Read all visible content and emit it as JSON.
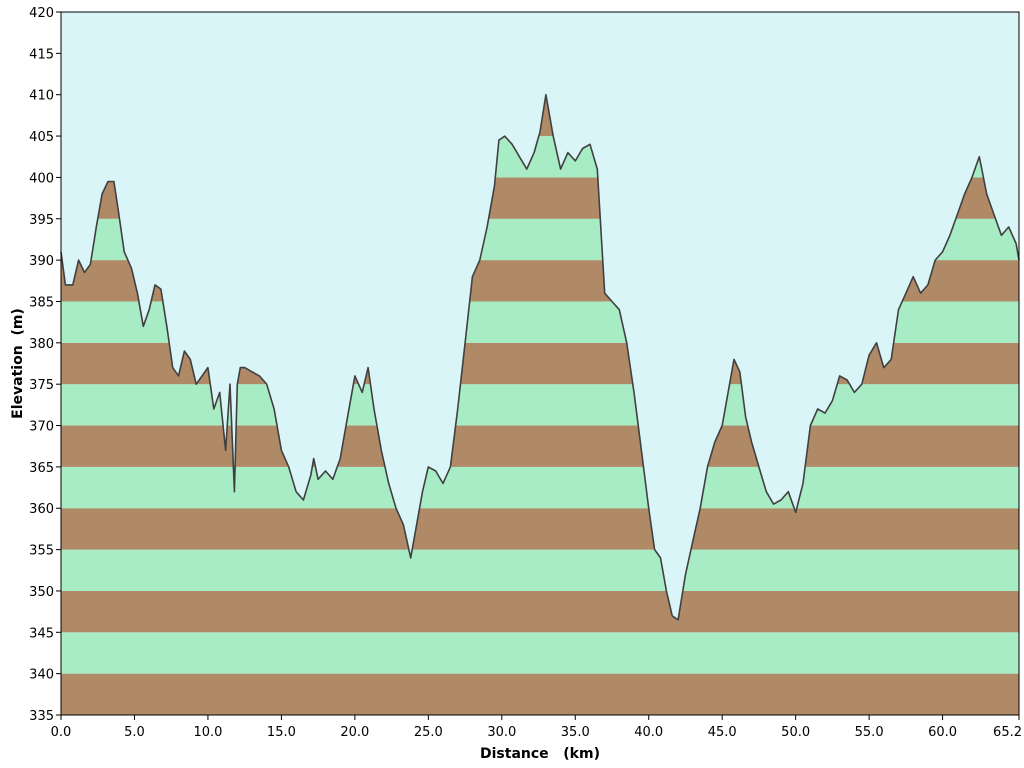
{
  "colors": {
    "sky": "#d9f5f7",
    "band_green": "#a8ecc6",
    "band_brown": "#b08a66",
    "profile_line": "#404040",
    "axis": "#000000"
  },
  "chart_data": {
    "type": "area",
    "title": "",
    "xlabel": "Distance   (km)",
    "ylabel": "Elevation  (m)",
    "xlim": [
      0,
      65.2
    ],
    "ylim": [
      335,
      420
    ],
    "grid": false,
    "x_ticks": [
      0,
      5,
      10,
      15,
      20,
      25,
      30,
      35,
      40,
      45,
      50,
      55,
      60,
      65.2
    ],
    "x_tick_labels": [
      "0.0",
      "5.0",
      "10.0",
      "15.0",
      "20.0",
      "25.0",
      "30.0",
      "35.0",
      "40.0",
      "45.0",
      "50.0",
      "55.0",
      "60.0",
      "65.2"
    ],
    "y_ticks": [
      335,
      340,
      345,
      350,
      355,
      360,
      365,
      370,
      375,
      380,
      385,
      390,
      395,
      400,
      405,
      410,
      415,
      420
    ],
    "y_tick_labels": [
      "335",
      "340",
      "345",
      "350",
      "355",
      "360",
      "365",
      "370",
      "375",
      "380",
      "385",
      "390",
      "395",
      "400",
      "405",
      "410",
      "415",
      "420"
    ],
    "band_height": 5,
    "series": [
      {
        "x": [
          0,
          0.3,
          0.8,
          1.2,
          1.6,
          2.0,
          2.4,
          2.8,
          3.2,
          3.6,
          3.9,
          4.3,
          4.8,
          5.2,
          5.6,
          6.0,
          6.4,
          6.8,
          7.2,
          7.6,
          8.0,
          8.4,
          8.8,
          9.2,
          9.6,
          10.0,
          10.4,
          10.8,
          11.2,
          11.5,
          11.8,
          12.0,
          12.2,
          12.5,
          13.0,
          13.5,
          14.0,
          14.5,
          15.0,
          15.5,
          16.0,
          16.5,
          17.0,
          17.2,
          17.5,
          18.0,
          18.5,
          19.0,
          19.5,
          20.0,
          20.5,
          20.9,
          21.3,
          21.8,
          22.3,
          22.8,
          23.3,
          23.8,
          24.2,
          24.6,
          25.0,
          25.5,
          26.0,
          26.5,
          27.0,
          27.5,
          28.0,
          28.5,
          29.0,
          29.5,
          29.8,
          30.2,
          30.7,
          31.2,
          31.7,
          32.2,
          32.6,
          33.0,
          33.5,
          34.0,
          34.5,
          35.0,
          35.5,
          36.0,
          36.5,
          37.0,
          37.5,
          38.0,
          38.5,
          39.0,
          39.5,
          40.0,
          40.4,
          40.8,
          41.2,
          41.6,
          42.0,
          42.5,
          43.0,
          43.5,
          44.0,
          44.5,
          45.0,
          45.4,
          45.8,
          46.2,
          46.6,
          47.0,
          47.5,
          48.0,
          48.5,
          49.0,
          49.5,
          50.0,
          50.5,
          51.0,
          51.5,
          52.0,
          52.5,
          53.0,
          53.5,
          54.0,
          54.5,
          55.0,
          55.5,
          56.0,
          56.5,
          57.0,
          57.5,
          58.0,
          58.5,
          59.0,
          59.5,
          60.0,
          60.5,
          61.0,
          61.5,
          62.0,
          62.5,
          63.0,
          63.5,
          64.0,
          64.5,
          65.0,
          65.2
        ],
        "y": [
          391,
          387,
          387,
          390,
          388.5,
          389.5,
          394,
          398,
          399.5,
          399.5,
          396,
          391,
          389,
          386,
          382,
          384,
          387,
          386.5,
          382,
          377,
          376,
          379,
          378,
          375,
          376,
          377,
          372,
          374,
          367,
          375,
          362,
          375,
          377,
          377,
          376.5,
          376,
          375,
          372,
          367,
          365,
          362,
          361,
          364,
          366,
          363.5,
          364.5,
          363.5,
          366,
          371,
          376,
          374,
          377,
          372,
          367,
          363,
          360,
          358,
          354,
          358,
          362,
          365,
          364.5,
          363,
          365,
          372,
          380,
          388,
          390,
          394,
          399,
          404.5,
          405,
          404,
          402.5,
          401,
          403,
          405.5,
          410,
          405,
          401,
          403,
          402,
          403.5,
          404,
          401,
          386,
          385,
          384,
          380,
          374,
          367,
          360,
          355,
          354,
          350,
          347,
          346.5,
          352,
          356,
          360,
          365,
          368,
          370,
          374,
          378,
          376.5,
          371,
          368,
          365,
          362,
          360.5,
          361,
          362,
          359.5,
          363,
          370,
          372,
          371.5,
          373,
          376,
          375.5,
          374,
          375,
          378.5,
          380,
          377,
          378,
          384,
          386,
          388,
          386,
          387,
          390,
          391,
          393,
          395.5,
          398,
          400,
          402.5,
          398,
          395.5,
          393,
          394,
          392,
          390
        ]
      }
    ]
  }
}
